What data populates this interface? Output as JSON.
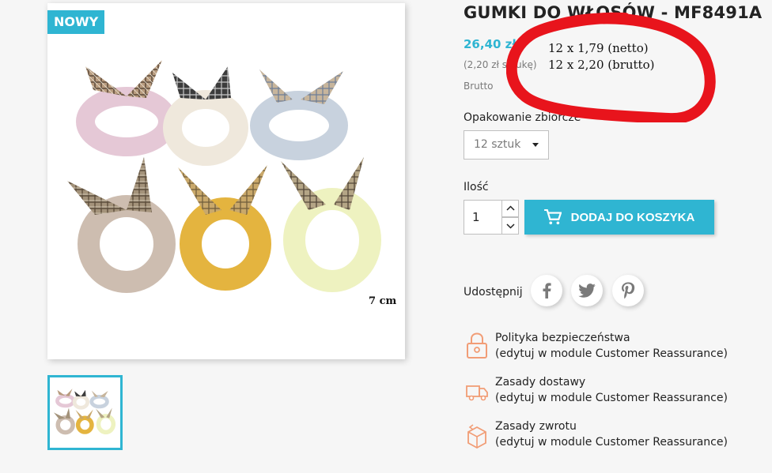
{
  "product": {
    "title": "GUMKI DO WŁOSÓW - MF8491A",
    "badge": "NOWY",
    "price": "26,40 zł",
    "unit_price": "(2,20 zł sztukę)",
    "tax_label": "Brutto",
    "size_label": "7 cm"
  },
  "annotation": {
    "line1": "12 x 1,79 (netto)",
    "line2": "12 x 2,20 (brutto)",
    "color": "#e8141c"
  },
  "packaging": {
    "label": "Opakowanie zbiorcze",
    "selected": "12 sztuk"
  },
  "quantity": {
    "label": "Ilość",
    "value": "1"
  },
  "cart": {
    "add_label": "DODAJ DO KOSZYKA"
  },
  "share": {
    "label": "Udostępnij",
    "networks": [
      "facebook-icon",
      "twitter-icon",
      "pinterest-icon"
    ]
  },
  "reassurance": [
    {
      "title": "Polityka bezpieczeństwa",
      "subtitle": "(edytuj w module Customer Reassurance)",
      "icon": "lock-icon"
    },
    {
      "title": "Zasady dostawy",
      "subtitle": "(edytuj w module Customer Reassurance)",
      "icon": "truck-icon"
    },
    {
      "title": "Zasady zwrotu",
      "subtitle": "(edytuj w module Customer Reassurance)",
      "icon": "return-box-icon"
    }
  ],
  "colors": {
    "accent": "#2fb5d2",
    "text": "#232323",
    "muted": "#7a7a7a",
    "background": "#f6f6f6"
  }
}
